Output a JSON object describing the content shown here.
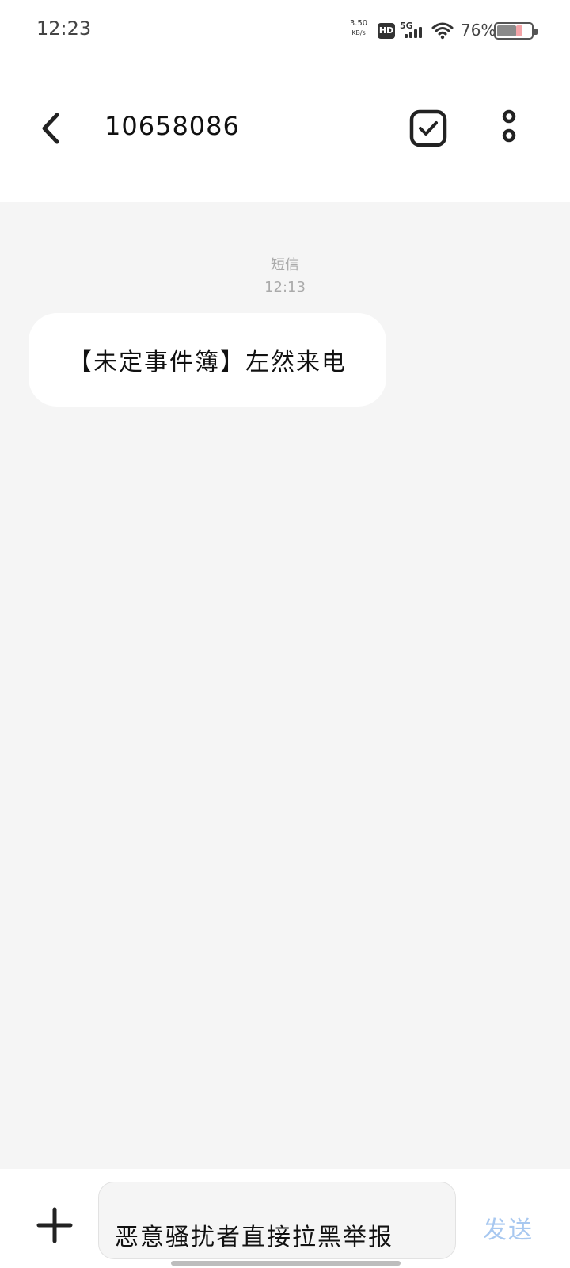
{
  "status_bar": {
    "time": "12:23",
    "net_speed_value": "3.50",
    "net_speed_unit": "KB/s",
    "hd_label": "HD",
    "network_label": "5G",
    "battery_percent": "76%",
    "battery_level": 0.76
  },
  "header": {
    "title": "10658086",
    "icons": [
      "back-chevron",
      "select-check",
      "more-vertical"
    ]
  },
  "conversation": {
    "messages": [
      {
        "type": "短信",
        "time": "12:13",
        "text": "【未定事件簿】左然来电",
        "direction": "incoming"
      }
    ]
  },
  "compose": {
    "input_value": "恶意骚扰者直接拉黑举报",
    "send_label": "发送",
    "send_color": "#a8c8f0",
    "icons": [
      "plus"
    ]
  }
}
